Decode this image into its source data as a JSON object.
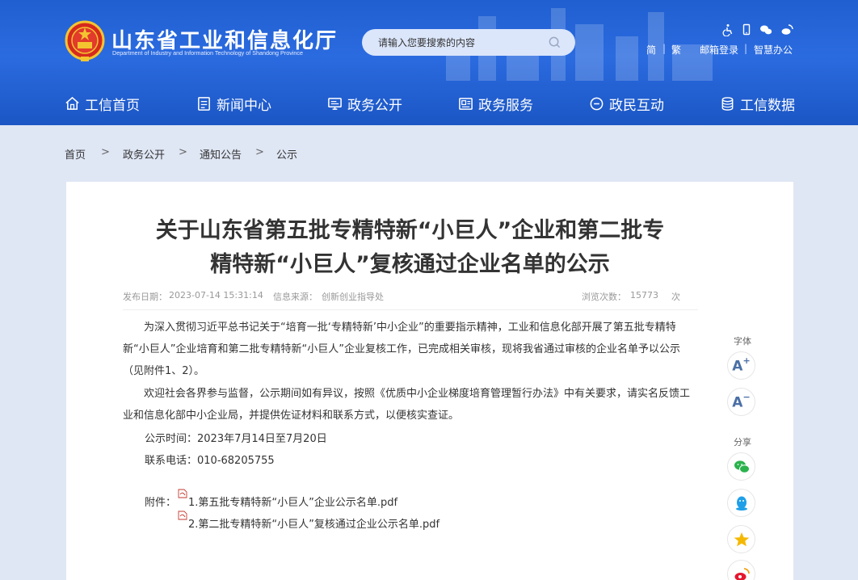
{
  "header": {
    "title": "山东省工业和信息化厅",
    "subtitle": "Department of Industry and Information Technology of Shandong Province",
    "search_placeholder": "请输入您要搜索的内容",
    "tools": [
      "accessibility-icon",
      "mobile-icon",
      "wechat-icon",
      "weibo-icon"
    ],
    "links": {
      "simplified": "简",
      "traditional": "繁",
      "mail": "邮箱登录",
      "office": "智慧办公",
      "sep": "|"
    }
  },
  "nav": {
    "items": [
      {
        "label": "工信首页",
        "icon": "home-icon"
      },
      {
        "label": "新闻中心",
        "icon": "news-icon"
      },
      {
        "label": "政务公开",
        "icon": "monitor-icon"
      },
      {
        "label": "政务服务",
        "icon": "service-icon"
      },
      {
        "label": "政民互动",
        "icon": "chat-icon"
      },
      {
        "label": "工信数据",
        "icon": "database-icon"
      }
    ]
  },
  "breadcrumb": {
    "items": [
      "首页",
      "政务公开",
      "通知公告",
      "公示"
    ],
    "sep": ">"
  },
  "article": {
    "title_line1": "关于山东省第五批专精特新“小巨人”企业和第二批专",
    "title_line2": "精特新“小巨人”复核通过企业名单的公示",
    "meta": {
      "date_label": "发布日期：",
      "date": "2023-07-14 15:31:14",
      "source_label": "信息来源：",
      "source": "创新创业指导处",
      "views_label": "浏览次数：",
      "views": "15773",
      "views_unit": "次"
    },
    "para1": "为深入贯彻习近平总书记关于“培育一批‘专精特新’中小企业”的重要指示精神，工业和信息化部开展了第五批专精特新“小巨人”企业培育和第二批专精特新“小巨人”企业复核工作，已完成相关审核，现将我省通过审核的企业名单予以公示（见附件1、2）。",
    "para2": "欢迎社会各界参与监督，公示期间如有异议，按照《优质中小企业梯度培育管理暂行办法》中有关要求，请实名反馈工业和信息化部中小企业局，并提供佐证材料和联系方式，以便核实查证。",
    "period": "公示时间：2023年7月14日至7月20日",
    "phone": "联系电话：010-68205755",
    "attachments_label": "附件：",
    "attachments": [
      "1.第五批专精特新“小巨人”企业公示名单.pdf",
      "2.第二批专精特新“小巨人”复核通过企业公示名单.pdf"
    ]
  },
  "sidebar": {
    "font_label": "字体",
    "font_increase": "A",
    "font_increase_sign": "+",
    "font_decrease": "A",
    "font_decrease_sign": "−",
    "share_label": "分享",
    "share_icons": [
      "wechat-share-icon",
      "qq-share-icon",
      "qzone-share-icon",
      "weibo-share-icon"
    ]
  },
  "colors": {
    "header_blue": "#2563d6",
    "page_bg": "#dfe6f4",
    "text": "#333333",
    "meta": "#999999"
  }
}
